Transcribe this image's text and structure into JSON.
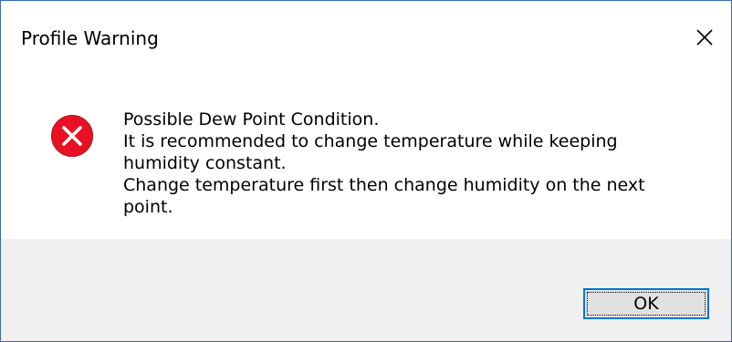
{
  "window": {
    "title": "Profile Warning",
    "close_icon": "close-icon"
  },
  "dialog": {
    "icon": "error-icon",
    "icon_color": "#e81123",
    "message_lines": [
      "Possible Dew Point Condition.",
      "It is recommended to change temperature while keeping",
      "humidity constant.",
      "Change temperature first then change humidity on the next",
      "point."
    ]
  },
  "buttons": {
    "ok_label": "OK",
    "focus_color": "#0078d7"
  }
}
